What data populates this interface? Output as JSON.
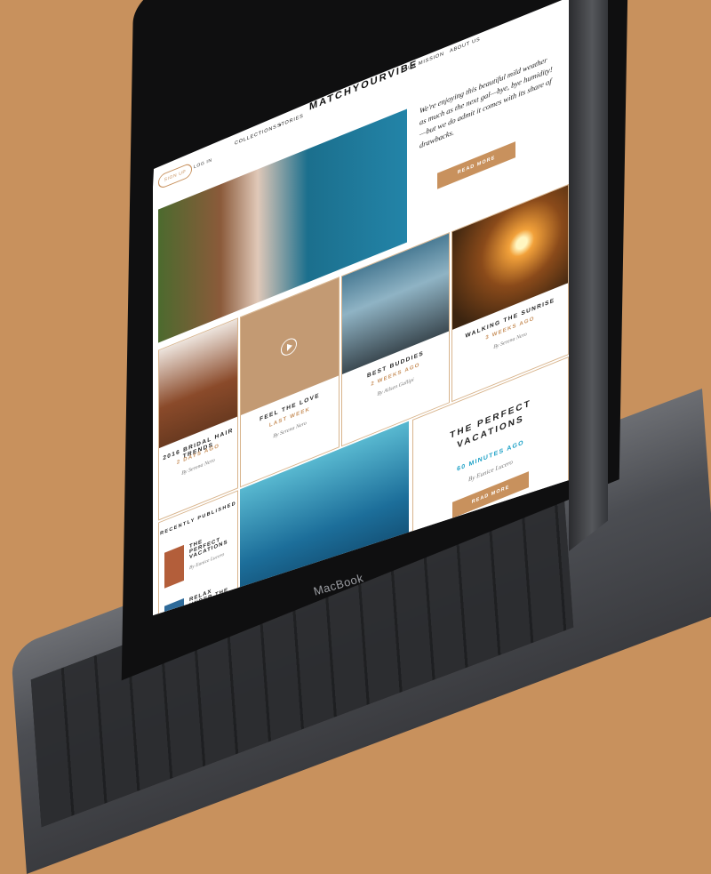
{
  "device": {
    "brand": "MacBook"
  },
  "nav": {
    "signup": "SIGN UP",
    "login": "LOG IN",
    "collections": "COLLECTIONS",
    "stories": "STORIES",
    "logo": "MATCHYOURVIBE",
    "mission": "OUR MISSION",
    "about": "ABOUT US"
  },
  "intro": {
    "text": "We're enjoying this beautiful mild weather as much as the next gal—bye, bye humidity!—but we do admit it comes with its share of drawbacks.",
    "button": "READ MORE"
  },
  "cards": [
    {
      "title": "WALKING THE SUNRISE",
      "when": "3 WEEKS AGO",
      "by": "By Serena Nero"
    },
    {
      "title": "BEST BUDDIES",
      "when": "2 WEEKS AGO",
      "by": "By Ailsen Gallipi"
    },
    {
      "title": "FEEL THE LOVE",
      "when": "LAST WEEK",
      "by": "By Serena Nero"
    },
    {
      "title": "2016 BRIDAL HAIR TRENDS",
      "when": "2 DAYS AGO",
      "by": "By Serena Nero"
    }
  ],
  "feature": {
    "title": "THE PERFECT VACATIONS",
    "when": "60 MINUTES AGO",
    "by": "By Eunice Lucero",
    "button": "READ MORE"
  },
  "recent": {
    "heading": "RECENTLY PUBLISHED",
    "items": [
      {
        "title": "THE PERFECT VACATIONS",
        "by": "By Eunice Lucero"
      },
      {
        "title": "RELAX UNDER THE STARS",
        "by": ""
      }
    ]
  },
  "colors": {
    "accent": "#c8915d",
    "background": "#c8915d",
    "feature_when": "#1ba0c6"
  },
  "icons": {
    "video": "play-icon",
    "dropdown": "chevron-down-icon"
  }
}
